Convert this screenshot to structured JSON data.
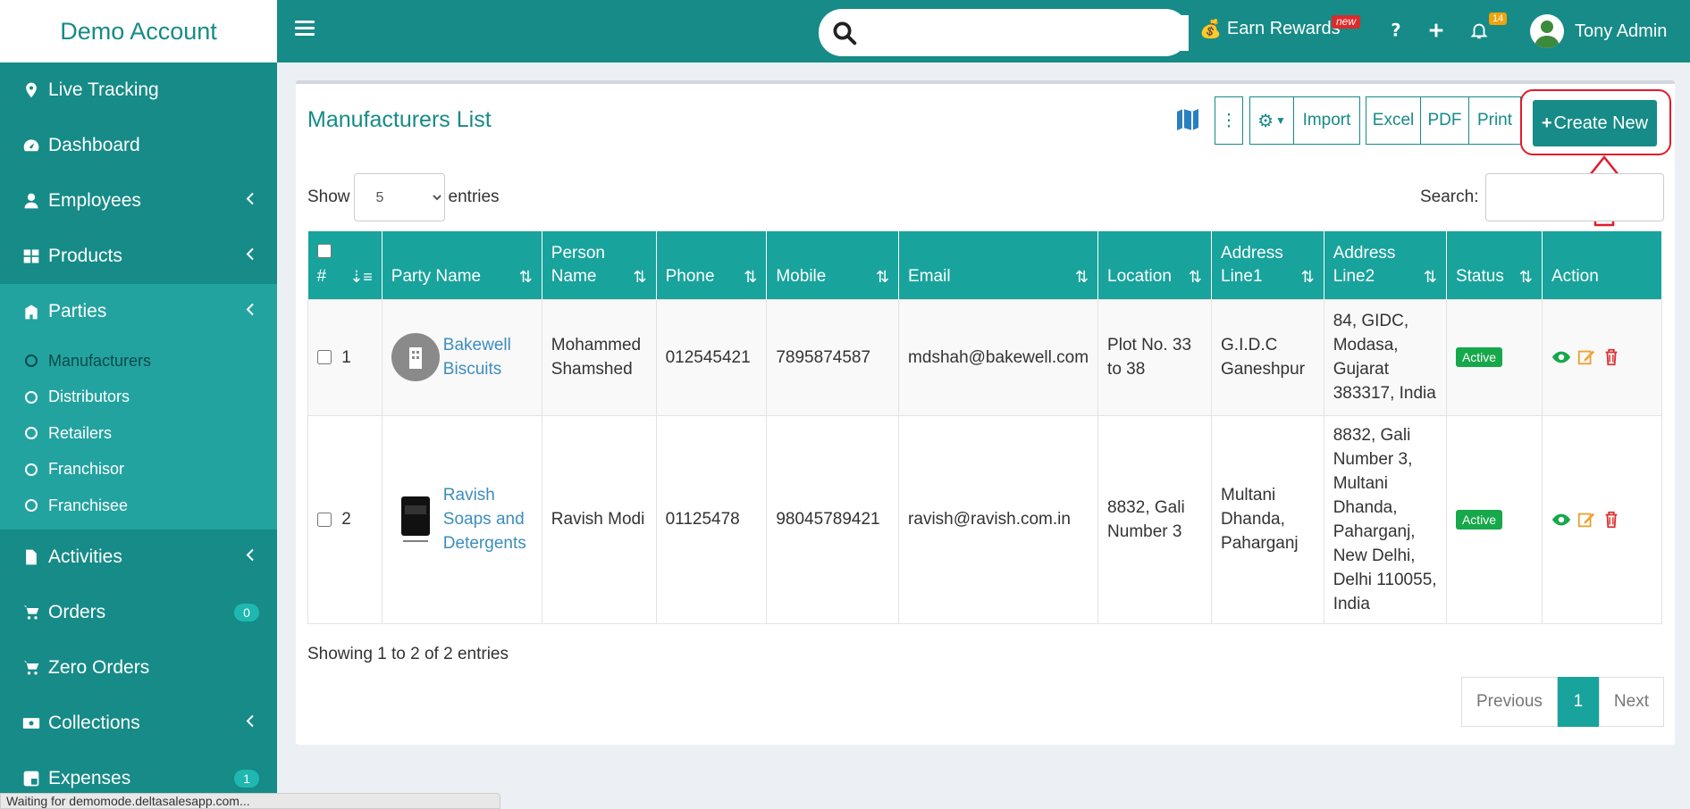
{
  "brand": {
    "title": "Demo Account"
  },
  "sidebar": {
    "items": [
      {
        "label": "Live Tracking",
        "icon": "map-pin-icon"
      },
      {
        "label": "Dashboard",
        "icon": "gauge-icon"
      },
      {
        "label": "Employees",
        "icon": "user-icon"
      },
      {
        "label": "Products",
        "icon": "grid-icon"
      },
      {
        "label": "Parties",
        "icon": "building-icon"
      },
      {
        "label": "Activities",
        "icon": "file-icon"
      },
      {
        "label": "Orders",
        "icon": "cart-icon",
        "badge": "0"
      },
      {
        "label": "Zero Orders",
        "icon": "cart-icon"
      },
      {
        "label": "Collections",
        "icon": "money-icon"
      },
      {
        "label": "Expenses",
        "icon": "square-icon",
        "badge": "1"
      }
    ],
    "parties_sub": [
      {
        "label": "Manufacturers"
      },
      {
        "label": "Distributors"
      },
      {
        "label": "Retailers"
      },
      {
        "label": "Franchisor"
      },
      {
        "label": "Franchisee"
      }
    ]
  },
  "topbar": {
    "search_placeholder": "",
    "rewards_label": "Earn Rewards",
    "new_tag": "new",
    "bell_count": "14",
    "user_name": "Tony Admin"
  },
  "main": {
    "title": "Manufacturers List",
    "toolbar": {
      "more_label": "⋮",
      "import_label": "Import",
      "excel_label": "Excel",
      "pdf_label": "PDF",
      "print_label": "Print",
      "create_label": "Create New"
    },
    "show_label": "Show",
    "entries_label": "entries",
    "page_size": "5",
    "search_label": "Search:",
    "columns": [
      "#",
      "Party Name",
      "Person Name",
      "Phone",
      "Mobile",
      "Email",
      "Location",
      "Address Line1",
      "Address Line2",
      "Status",
      "Action"
    ],
    "rows": [
      {
        "num": "1",
        "party": "Bakewell Biscuits",
        "person": "Mohammed Shamshed",
        "phone": "012545421",
        "mobile": "7895874587",
        "email": "mdshah@bakewell.com",
        "location": "Plot No. 33 to 38",
        "addr1": "G.I.D.C Ganeshpur",
        "addr2": "84, GIDC, Modasa, Gujarat 383317, India",
        "status": "Active"
      },
      {
        "num": "2",
        "party": "Ravish Soaps and Detergents",
        "person": "Ravish Modi",
        "phone": "01125478",
        "mobile": "98045789421",
        "email": "ravish@ravish.com.in",
        "location": "8832, Gali Number 3",
        "addr1": "Multani Dhanda, Paharganj",
        "addr2": "8832, Gali Number 3, Multani Dhanda, Paharganj, New Delhi, Delhi 110055, India",
        "status": "Active"
      }
    ],
    "info": "Showing 1 to 2 of 2 entries",
    "pager": {
      "prev": "Previous",
      "current": "1",
      "next": "Next"
    }
  },
  "statusbar": {
    "text": "Waiting for demomode.deltasalesapp.com..."
  },
  "colors": {
    "primary": "#168b87",
    "header": "#18a39c",
    "active_status": "#16a84a",
    "highlight": "#e01c2c"
  }
}
